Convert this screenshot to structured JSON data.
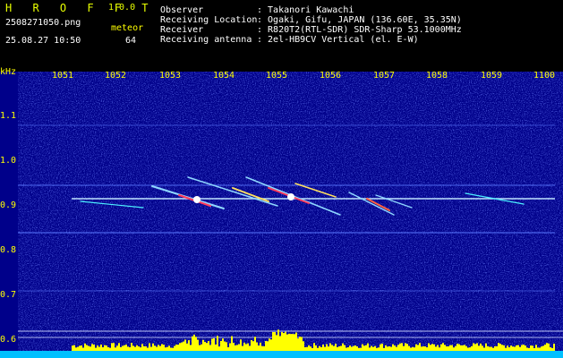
{
  "app": {
    "title": "H R O F F T",
    "version": "1.0.0",
    "filename": "2508271050.png",
    "mode": "meteor",
    "datetime": "25.08.27 10:50",
    "count": "64"
  },
  "info": {
    "observer_label": "Observer",
    "observer_value": ": Takanori Kawachi",
    "location_label": "Receiving Location",
    "location_value": ": Ogaki, Gifu, JAPAN (136.60E, 35.35N)",
    "receiver_label": "Receiver",
    "receiver_value": ": R820T2(RTL-SDR) SDR-Sharp 53.1000MHz",
    "antenna_label": "Receiving antenna",
    "antenna_value": ": 2el-HB9CV Vertical (el. E-W)"
  },
  "axes": {
    "y_unit": "kHz",
    "y_ticks": [
      "1.1",
      "1.0",
      "0.9",
      "0.8",
      "0.7",
      "0.6"
    ],
    "x_ticks": [
      "1051",
      "1052",
      "1053",
      "1054",
      "1055",
      "1056",
      "1057",
      "1058",
      "1059",
      "1100"
    ]
  },
  "colors": {
    "background": "#000000",
    "spectrogram": "#00008a",
    "noise": "#2a3cff",
    "signal": "#9fd0ff",
    "meteor_hot": "#ff3050",
    "level_bars": "#ffff00",
    "level_base": "#00c0ff",
    "text_yellow": "#ffff00",
    "text_white": "#ffffff"
  }
}
